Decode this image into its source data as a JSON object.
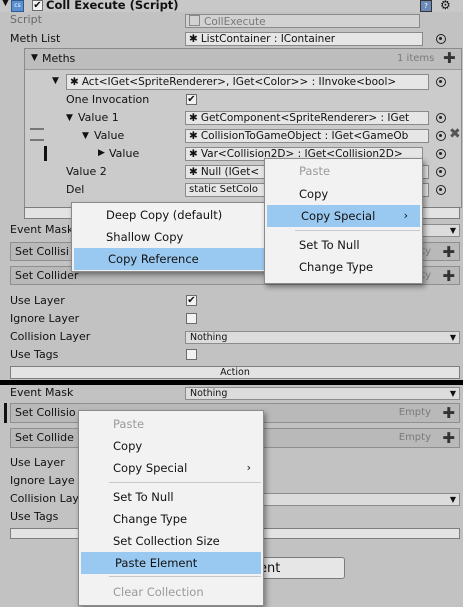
{
  "header": {
    "title": "Coll Execute (Script)"
  },
  "script_row": {
    "label": "Script",
    "value": "CollExecute"
  },
  "meth_list": {
    "label": "Meth List",
    "value": "ListContainer : IContainer"
  },
  "meths": {
    "label": "Meths",
    "count": "1 items",
    "act_value": "Act<IGet<SpriteRenderer>, IGet<Color>> : IInvoke<bool>",
    "one_invocation_label": "One Invocation",
    "value1_label": "Value 1",
    "value1_field": "GetComponent<SpriteRenderer> : IGet",
    "value_label": "Value",
    "value_field": "CollisionToGameObject : IGet<GameOb",
    "value_inner_label": "Value",
    "value_inner_field": "Var<Collision2D> : IGet<Collision2D>",
    "value2_label": "Value 2",
    "value2_field": "Null (IGet<",
    "del_label": "Del",
    "del_field": "static SetColo"
  },
  "top": {
    "event_mask_label": "Event Mask",
    "set_collision_label": "Set Collisi",
    "set_collider_label": "Set Collider",
    "empty": "Empty",
    "use_layer": "Use Layer",
    "ignore_layer": "Ignore Layer",
    "collision_layer": "Collision Layer",
    "collision_layer_value": "Nothing",
    "use_tags": "Use Tags",
    "action": "Action"
  },
  "bottom": {
    "event_mask_label": "Event Mask",
    "event_mask_value": "Nothing",
    "set_collision_label": "Set Collisio",
    "set_collider_label": "Set Collide",
    "empty": "Empty",
    "use_layer": "Use Layer",
    "ignore_layer": "Ignore Laye",
    "collision_layer": "Collision Lay",
    "use_tags": "Use Tags",
    "bottom_button": "ent"
  },
  "menu_a": {
    "paste": "Paste",
    "copy": "Copy",
    "copy_special": "Copy Special",
    "set_to_null": "Set To Null",
    "change_type": "Change Type"
  },
  "menu_b": {
    "deep_copy": "Deep Copy (default)",
    "shallow_copy": "Shallow Copy",
    "copy_reference": "Copy Reference"
  },
  "menu_c": {
    "paste": "Paste",
    "copy": "Copy",
    "copy_special": "Copy Special",
    "set_to_null": "Set To Null",
    "change_type": "Change Type",
    "set_collection_size": "Set Collection Size",
    "paste_element": "Paste Element",
    "clear_collection": "Clear Collection"
  },
  "colors": {
    "highlight": "#99c9f1",
    "panel": "#c2c2c2",
    "divider": "#000000"
  }
}
